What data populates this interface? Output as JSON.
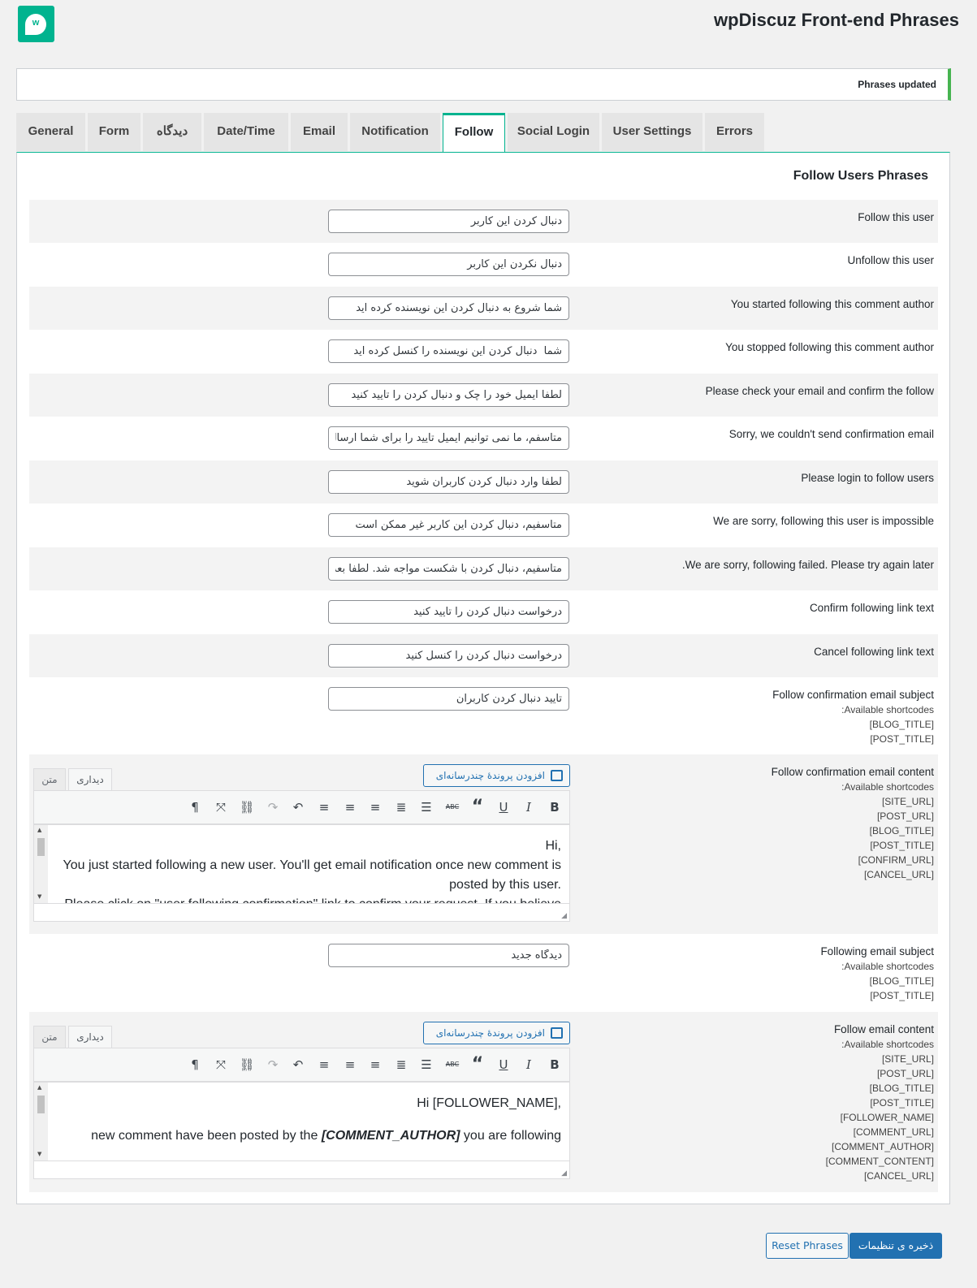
{
  "header": {
    "title": "wpDiscuz Front-end Phrases",
    "logo_letter": "w"
  },
  "notice": {
    "text": "Phrases updated"
  },
  "tabs": [
    {
      "label": "General"
    },
    {
      "label": "Form"
    },
    {
      "label": "دیدگاه"
    },
    {
      "label": "Date/Time"
    },
    {
      "label": "Email"
    },
    {
      "label": "Notification"
    },
    {
      "label": "Follow"
    },
    {
      "label": "Social Login"
    },
    {
      "label": "User Settings"
    },
    {
      "label": "Errors"
    }
  ],
  "active_tab": "Follow",
  "section": {
    "title": "Follow Users Phrases"
  },
  "rows": [
    {
      "label": "Follow this user",
      "value": "دنبال کردن این کاربر"
    },
    {
      "label": "Unfollow this user",
      "value": "دنبال نکردن این کاربر"
    },
    {
      "label": "You started following this comment author",
      "value": "شما شروع به دنبال کردن این نویسنده کرده اید"
    },
    {
      "label": "You stopped following this comment author",
      "value": "شما  دنبال کردن این نویسنده را کنسل کرده اید"
    },
    {
      "label": "Please check your email and confirm the follow",
      "value": "لطفا ایمیل خود را چک و دنبال کردن را تایید کنید"
    },
    {
      "label": "Sorry, we couldn't send confirmation email",
      "value": "متاسفم، ما نمی توانیم ایمیل تایید را برای شما ارسال کنیم"
    },
    {
      "label": "Please login to follow users",
      "value": "لطفا وارد دنبال کردن کاربران شوید"
    },
    {
      "label": "We are sorry, following this user is impossible",
      "value": "متاسفیم، دنبال کردن این کاربر غیر ممکن است"
    },
    {
      "label": ".We are sorry, following failed. Please try again later",
      "value": "متاسفیم، دنبال کردن با شکست مواجه شد. لطفا بعدا دوباره تلاش کنید"
    },
    {
      "label": "Confirm following link text",
      "value": "درخواست دنبال کردن را تایید کنید"
    },
    {
      "label": "Cancel following link text",
      "value": "درخواست دنبال کردن را کنسل کنید"
    }
  ],
  "confirm_subject": {
    "label": "Follow confirmation email subject",
    "shortcodes_label": ":Available shortcodes",
    "shortcodes": [
      "[BLOG_TITLE]",
      "[POST_TITLE]"
    ],
    "value": "تایید دنبال کردن کاربران"
  },
  "confirm_content": {
    "label": "Follow confirmation email content",
    "shortcodes_label": ":Available shortcodes",
    "shortcodes": [
      "[SITE_URL]",
      "[POST_URL]",
      "[BLOG_TITLE]",
      "[POST_TITLE]",
      "[CONFIRM_URL]",
      "[CANCEL_URL]"
    ],
    "media_button": "افزودن پروندهٔ چندرسانه‌ای",
    "tab_visual": "دیداری",
    "tab_text": "متن",
    "line1": "Hi,",
    "line2": "You just started following a new user. You'll get email notification once new comment is posted by this user.",
    "line3": "Please click on \"user following confirmation\" link to confirm your request. If you believe"
  },
  "following_subject": {
    "label": "Following email subject",
    "shortcodes_label": ":Available shortcodes",
    "shortcodes": [
      "[BLOG_TITLE]",
      "[POST_TITLE]"
    ],
    "value": "دیدگاه جدید"
  },
  "follow_content": {
    "label": "Follow email content",
    "shortcodes_label": ":Available shortcodes",
    "shortcodes": [
      "[SITE_URL]",
      "[POST_URL]",
      "[BLOG_TITLE]",
      "[POST_TITLE]",
      "[FOLLOWER_NAME]",
      "[COMMENT_URL]",
      "[COMMENT_AUTHOR]",
      "[COMMENT_CONTENT]",
      "[CANCEL_URL]"
    ],
    "media_button": "افزودن پروندهٔ چندرسانه‌ای",
    "tab_visual": "دیداری",
    "tab_text": "متن",
    "line1": "Hi [FOLLOWER_NAME],",
    "line2_pre": "new comment have been posted by the",
    "line2_author": "[COMMENT_AUTHOR]",
    "line2_post": "you are following"
  },
  "toolbar_icons": [
    "bold-icon",
    "italic-icon",
    "underline-icon",
    "blockquote-icon",
    "strikethrough-icon",
    "bullet-list-icon",
    "numbered-list-icon",
    "align-left-icon",
    "align-center-icon",
    "align-right-icon",
    "undo-icon",
    "redo-icon",
    "link-icon",
    "fullscreen-icon",
    "paragraph-direction-icon"
  ],
  "buttons": {
    "reset": "Reset Phrases",
    "save": "ذخیره ی تنظیمات"
  },
  "colors": {
    "accent": "#00b38f",
    "primary": "#2271b1",
    "success": "#46b450"
  }
}
